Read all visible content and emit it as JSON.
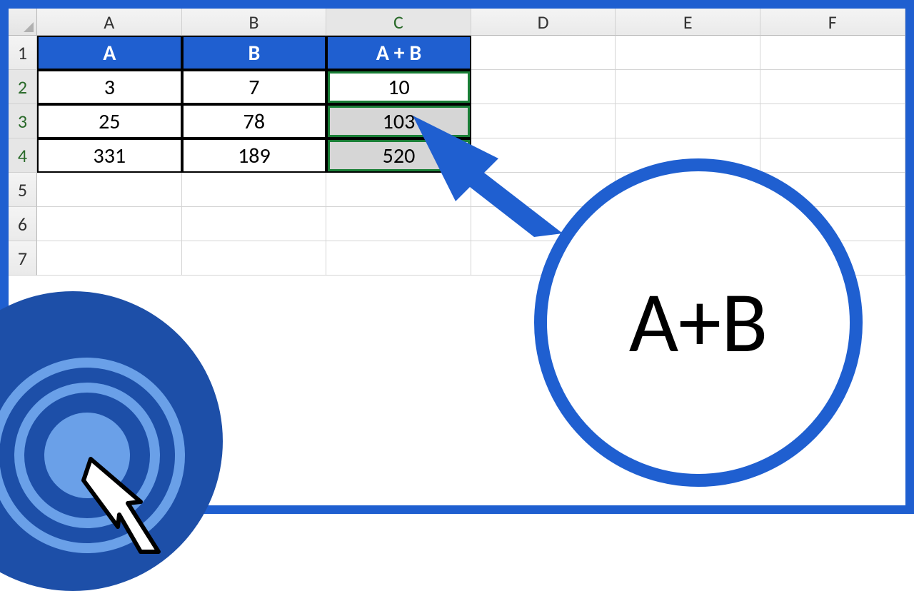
{
  "columns": [
    "A",
    "B",
    "C",
    "D",
    "E",
    "F"
  ],
  "rows": [
    "1",
    "2",
    "3",
    "4",
    "5",
    "6",
    "7"
  ],
  "table": {
    "headers": [
      "A",
      "B",
      "A + B"
    ],
    "data": [
      {
        "a": "3",
        "b": "7",
        "sum": "10"
      },
      {
        "a": "25",
        "b": "78",
        "sum": "103"
      },
      {
        "a": "331",
        "b": "189",
        "sum": "520"
      }
    ]
  },
  "selected_rows": [
    "2",
    "3",
    "4"
  ],
  "selected_col": "C",
  "annotation": {
    "label": "A+B"
  },
  "chart_data": {
    "type": "table",
    "title": "A + B",
    "columns": [
      "A",
      "B",
      "A + B"
    ],
    "rows": [
      [
        3,
        7,
        10
      ],
      [
        25,
        78,
        103
      ],
      [
        331,
        189,
        520
      ]
    ]
  }
}
